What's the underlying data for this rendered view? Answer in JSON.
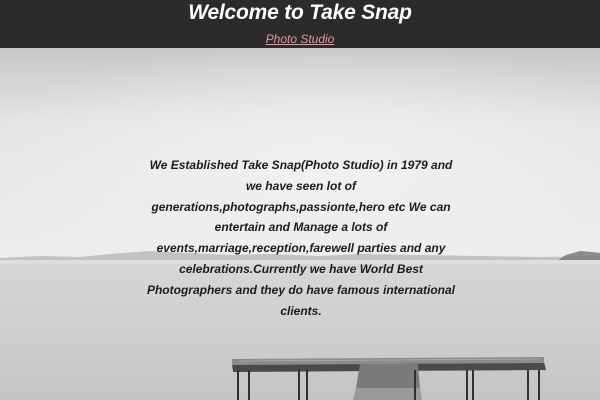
{
  "header": {
    "title": "Welcome to Take Snap",
    "subtitle_link": "Photo Studio"
  },
  "main": {
    "about_text": "We Established Take Snap(Photo Studio) in 1979 and we have seen lot of generations,photographs,passionte,hero etc We can entertain and Manage a lots of events,marriage,reception,farewell parties and any celebrations.Currently we have World Best Photographers and they do have famous international clients."
  },
  "colors": {
    "header_bg": "#2b2b2b",
    "title_text": "#ffffff",
    "link_text": "#e8959a",
    "body_text": "#1c1c1c"
  }
}
